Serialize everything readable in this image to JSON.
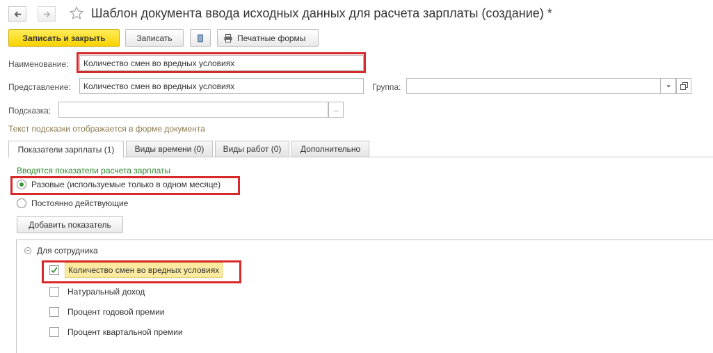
{
  "window": {
    "title": "Шаблон документа ввода исходных данных для расчета зарплаты (создание) *"
  },
  "toolbar": {
    "save_close_label": "Записать и закрыть",
    "save_label": "Записать",
    "print_forms_label": "Печатные формы"
  },
  "form": {
    "name_label": "Наименование:",
    "name_value": "Количество смен во вредных условиях",
    "representation_label": "Представление:",
    "representation_value": "Количество смен во вредных условиях",
    "group_label": "Группа:",
    "group_value": "",
    "hint_label": "Подсказка:",
    "hint_value": "",
    "hint_button": "...",
    "hint_note": "Текст подсказки отображается в форме документа"
  },
  "tabs": [
    {
      "label": "Показатели зарплаты (1)",
      "active": true
    },
    {
      "label": "Виды времени (0)",
      "active": false
    },
    {
      "label": "Виды работ (0)",
      "active": false
    },
    {
      "label": "Дополнительно",
      "active": false
    }
  ],
  "indicators": {
    "group_title": "Вводятся показатели расчета зарплаты",
    "options": [
      {
        "label": "Разовые (используемые только в одном месяце)",
        "selected": true
      },
      {
        "label": "Постоянно действующие",
        "selected": false
      }
    ],
    "add_button": "Добавить показатель"
  },
  "tree": {
    "group_label": "Для сотрудника",
    "items": [
      {
        "label": "Количество смен во вредных условиях",
        "checked": true
      },
      {
        "label": "Натуральный доход",
        "checked": false
      },
      {
        "label": "Процент годовой премии",
        "checked": false
      },
      {
        "label": "Процент квартальной премии",
        "checked": false
      }
    ]
  },
  "colors": {
    "primary_button": "#f8d200",
    "highlight_border": "#d7282a",
    "group_title": "#2e8b2e",
    "hint_note": "#8a7a4f",
    "selected_row": "#fbeaa0"
  },
  "icons": {
    "back": "arrow-left-icon",
    "forward": "arrow-right-icon",
    "favorite": "star-icon",
    "list": "document-list-icon",
    "print": "printer-icon",
    "dropdown": "chevron-down-icon",
    "open": "open-window-icon",
    "collapse": "collapse-icon",
    "check": "checkmark-icon"
  }
}
